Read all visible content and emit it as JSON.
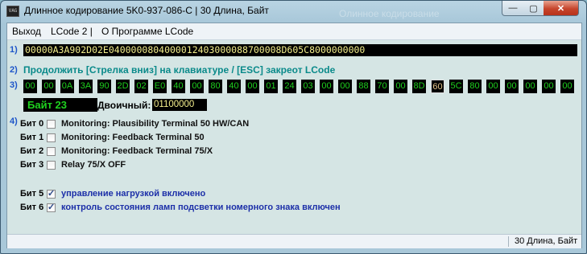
{
  "window": {
    "title": "Длинное кодирование  5K0-937-086-C | 30 Длина, Байт",
    "ghost_title": "Олинное кодирование",
    "icon_text": "VAG",
    "buttons": {
      "minimize": "—",
      "maximize": "▢",
      "close": "✕"
    }
  },
  "menu": [
    "Выход",
    "LCode 2 |",
    "О Программе LCode"
  ],
  "rows": {
    "r1": "1)",
    "r2": "2)",
    "r3": "3)",
    "r4": "4)"
  },
  "coding_string": "00000A3A902D02E0400000804000012403000088700008D605C8000000000",
  "hint": "Продолжить [Стрелка вниз] на клавиатуре / [ESC] закреот LCode",
  "bytes": [
    "00",
    "00",
    "0A",
    "3A",
    "90",
    "2D",
    "02",
    "E0",
    "40",
    "00",
    "80",
    "40",
    "00",
    "01",
    "24",
    "03",
    "00",
    "00",
    "88",
    "70",
    "00",
    "8D",
    "60",
    "5C",
    "80",
    "00",
    "00",
    "00",
    "00",
    "00"
  ],
  "selected_byte_index": 22,
  "byte_label": "Байт 23",
  "binary_label": "Двоичный:",
  "binary_value": "01100000",
  "bits": [
    {
      "label": "Бит 0",
      "checked": false,
      "text": "Monitoring: Plausibility Terminal 50 HW/CAN",
      "blue": false
    },
    {
      "label": "Бит 1",
      "checked": false,
      "text": "Monitoring: Feedback Terminal 50",
      "blue": false
    },
    {
      "label": "Бит 2",
      "checked": false,
      "text": "Monitoring: Feedback Terminal 75/X",
      "blue": false
    },
    {
      "label": "Бит 3",
      "checked": false,
      "text": "Relay 75/X OFF",
      "blue": false
    },
    {
      "label": "Бит 5",
      "checked": true,
      "text": "управление нагрузкой включено",
      "blue": true
    },
    {
      "label": "Бит 6",
      "checked": true,
      "text": "контроль состояния ламп подсветки номерного знака включен",
      "blue": true
    }
  ],
  "status": "30 Длина, Байт",
  "colors": {
    "hex_green": "#1fd11f",
    "yellow": "#f3ee8c",
    "accent_blue": "#1e56c9",
    "hint_teal": "#0a8a8a"
  }
}
